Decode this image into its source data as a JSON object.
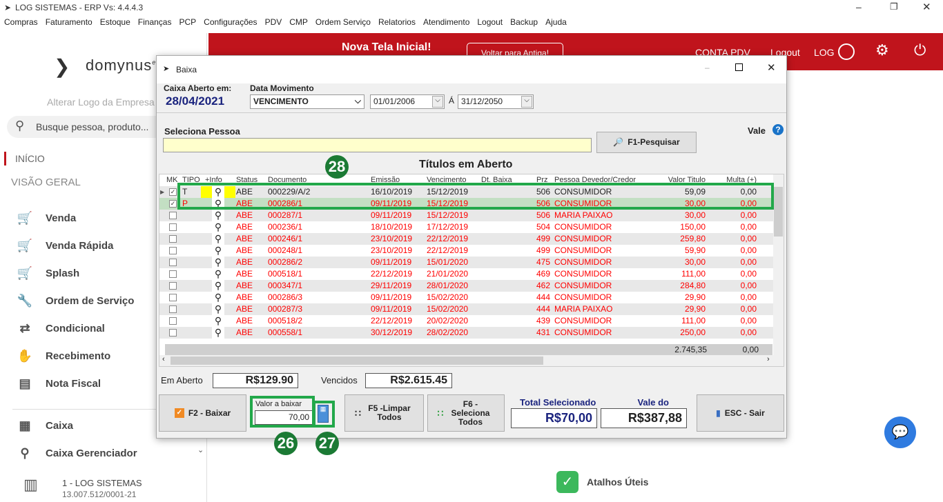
{
  "window": {
    "title": "LOG SISTEMAS - ERP Vs: 4.4.4.3"
  },
  "menu": [
    "Compras",
    "Faturamento",
    "Estoque",
    "Finanças",
    "PCP",
    "Configurações",
    "PDV",
    "CMP",
    "Ordem Serviço",
    "Relatorios",
    "Atendimento",
    "Logout",
    "Backup",
    "Ajuda"
  ],
  "sidebar": {
    "logo": "domynus",
    "logo_sup": "erp",
    "change_logo": "Alterar Logo da Empresa",
    "search_placeholder": "Busque pessoa, produto...",
    "inicio": "INÍCIO",
    "visao": "VISÃO GERAL",
    "items": [
      {
        "label": "Venda",
        "icon": "cart-icon"
      },
      {
        "label": "Venda Rápida",
        "icon": "cart-fast-icon"
      },
      {
        "label": "Splash",
        "icon": "cart-dollar-icon"
      },
      {
        "label": "Ordem de Serviço",
        "icon": "wrench-icon"
      },
      {
        "label": "Condicional",
        "icon": "cart-arrows-icon"
      },
      {
        "label": "Recebimento",
        "icon": "hand-money-icon"
      },
      {
        "label": "Nota Fiscal",
        "icon": "nfe-icon"
      }
    ],
    "items2": [
      {
        "label": "Caixa",
        "icon": "register-icon"
      },
      {
        "label": "Caixa Gerenciador",
        "icon": "user-icon"
      }
    ],
    "company": "1 - LOG SISTEMAS",
    "cnpj": "13.007.512/0001-21"
  },
  "header": {
    "title": "Nova Tela Inicial!",
    "back": "Voltar para Antiga!",
    "conta": "CONTA PDV",
    "logout": "Logout",
    "user": "LOG"
  },
  "atalhos": "Atalhos Úteis",
  "dialog": {
    "title": "Baixa",
    "caixa_label": "Caixa Aberto em:",
    "caixa_date": "28/04/2021",
    "data_mov_label": "Data Movimento",
    "data_mov": "VENCIMENTO",
    "date_from": "01/01/2006",
    "a": "Á",
    "date_to": "31/12/2050",
    "pessoa_label": "Seleciona Pessoa",
    "pessoa_value": "",
    "search_btn": "F1-Pesquisar",
    "vale": "Vale",
    "grid_title": "Títulos em Aberto",
    "columns": [
      "MK",
      "TIPO",
      "+Info",
      "Status",
      "Documento",
      "Emissão",
      "Vencimento",
      "Dt. Baixa",
      "Prz",
      "Pessoa Devedor/Credor",
      "Valor Titulo",
      "Multa (+)"
    ],
    "rows": [
      {
        "mk": true,
        "tipo": "T",
        "status": "ABE",
        "doc": "000229/A/2",
        "em": "16/10/2019",
        "venc": "15/12/2019",
        "baixa": "",
        "prz": "506",
        "pessoa": "CONSUMIDOR",
        "valor": "59,09",
        "multa": "0,00",
        "red": false
      },
      {
        "mk": true,
        "tipo": "P",
        "status": "ABE",
        "doc": "000286/1",
        "em": "09/11/2019",
        "venc": "15/12/2019",
        "baixa": "",
        "prz": "506",
        "pessoa": "CONSUMIDOR",
        "valor": "30,00",
        "multa": "0,00",
        "red": true
      },
      {
        "mk": false,
        "tipo": "",
        "status": "ABE",
        "doc": "000287/1",
        "em": "09/11/2019",
        "venc": "15/12/2019",
        "baixa": "",
        "prz": "506",
        "pessoa": "MARIA PAIXAO",
        "valor": "30,00",
        "multa": "0,00",
        "red": true
      },
      {
        "mk": false,
        "tipo": "",
        "status": "ABE",
        "doc": "000236/1",
        "em": "18/10/2019",
        "venc": "17/12/2019",
        "baixa": "",
        "prz": "504",
        "pessoa": "CONSUMIDOR",
        "valor": "150,00",
        "multa": "0,00",
        "red": true
      },
      {
        "mk": false,
        "tipo": "",
        "status": "ABE",
        "doc": "000246/1",
        "em": "23/10/2019",
        "venc": "22/12/2019",
        "baixa": "",
        "prz": "499",
        "pessoa": "CONSUMIDOR",
        "valor": "259,80",
        "multa": "0,00",
        "red": true
      },
      {
        "mk": false,
        "tipo": "",
        "status": "ABE",
        "doc": "000248/1",
        "em": "23/10/2019",
        "venc": "22/12/2019",
        "baixa": "",
        "prz": "499",
        "pessoa": "CONSUMIDOR",
        "valor": "59,90",
        "multa": "0,00",
        "red": true
      },
      {
        "mk": false,
        "tipo": "",
        "status": "ABE",
        "doc": "000286/2",
        "em": "09/11/2019",
        "venc": "15/01/2020",
        "baixa": "",
        "prz": "475",
        "pessoa": "CONSUMIDOR",
        "valor": "30,00",
        "multa": "0,00",
        "red": true
      },
      {
        "mk": false,
        "tipo": "",
        "status": "ABE",
        "doc": "000518/1",
        "em": "22/12/2019",
        "venc": "21/01/2020",
        "baixa": "",
        "prz": "469",
        "pessoa": "CONSUMIDOR",
        "valor": "111,00",
        "multa": "0,00",
        "red": true
      },
      {
        "mk": false,
        "tipo": "",
        "status": "ABE",
        "doc": "000347/1",
        "em": "29/11/2019",
        "venc": "28/01/2020",
        "baixa": "",
        "prz": "462",
        "pessoa": "CONSUMIDOR",
        "valor": "284,80",
        "multa": "0,00",
        "red": true
      },
      {
        "mk": false,
        "tipo": "",
        "status": "ABE",
        "doc": "000286/3",
        "em": "09/11/2019",
        "venc": "15/02/2020",
        "baixa": "",
        "prz": "444",
        "pessoa": "CONSUMIDOR",
        "valor": "29,90",
        "multa": "0,00",
        "red": true
      },
      {
        "mk": false,
        "tipo": "",
        "status": "ABE",
        "doc": "000287/3",
        "em": "09/11/2019",
        "venc": "15/02/2020",
        "baixa": "",
        "prz": "444",
        "pessoa": "MARIA PAIXAO",
        "valor": "29,90",
        "multa": "0,00",
        "red": true
      },
      {
        "mk": false,
        "tipo": "",
        "status": "ABE",
        "doc": "000518/2",
        "em": "22/12/2019",
        "venc": "20/02/2020",
        "baixa": "",
        "prz": "439",
        "pessoa": "CONSUMIDOR",
        "valor": "111,00",
        "multa": "0,00",
        "red": true
      },
      {
        "mk": false,
        "tipo": "",
        "status": "ABE",
        "doc": "000558/1",
        "em": "30/12/2019",
        "venc": "28/02/2020",
        "baixa": "",
        "prz": "431",
        "pessoa": "CONSUMIDOR",
        "valor": "250,00",
        "multa": "0,00",
        "red": true
      }
    ],
    "total_valor": "2.745,35",
    "total_multa": "0,00",
    "em_aberto_label": "Em Aberto",
    "em_aberto": "R$129.90",
    "vencidos_label": "Vencidos",
    "vencidos": "R$2.615.45",
    "baixar_btn": "F2 - Baixar",
    "valor_baixar_label": "Valor a baixar",
    "valor_baixar": "70,00",
    "limpar_btn": "F5 -Limpar Todos",
    "seleciona_btn": "F6 - Seleciona Todos",
    "total_sel_label": "Total Selecionado",
    "total_sel": "R$70,00",
    "vale_cliente_label": "Vale do Cliente",
    "vale_cliente": "R$387,88",
    "sair_btn": "ESC - Sair"
  },
  "annotations": [
    "26",
    "27",
    "28"
  ],
  "colors": {
    "brand_red": "#c0141c",
    "annotation_green": "#22a84a",
    "red_text": "#ff0000",
    "navy": "#1a237e"
  }
}
